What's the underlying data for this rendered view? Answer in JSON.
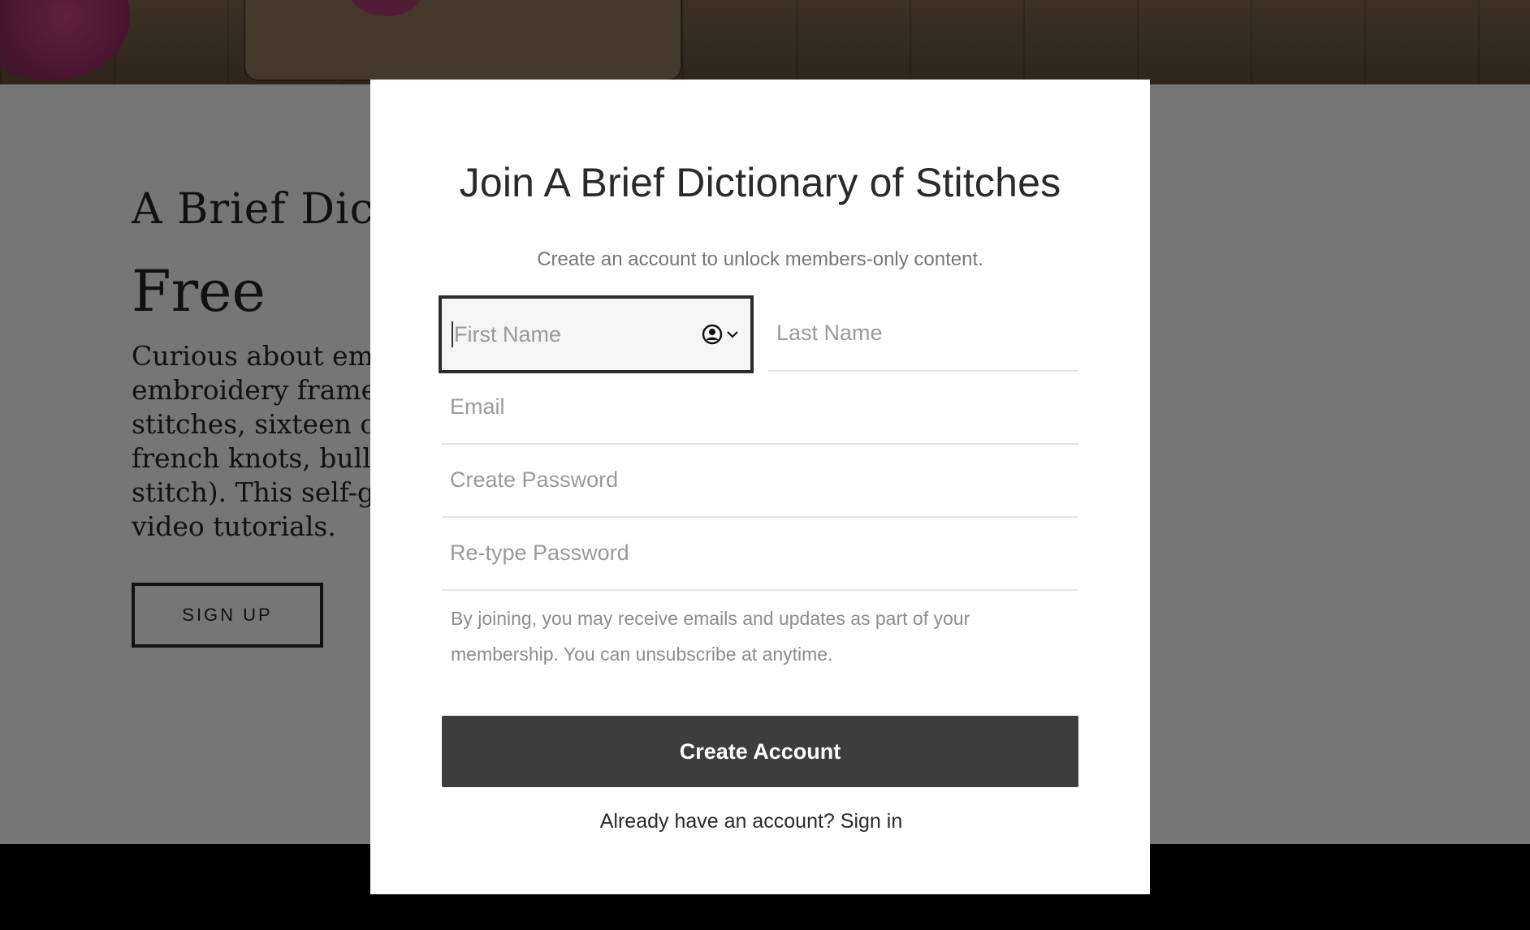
{
  "background": {
    "title": "A Brief Dictionary of Stitches",
    "subtitle": "Free",
    "paragraph_lines": [
      "Curious about embroidery? Learn how to set-up an",
      "embroidery frame, transfer designs onto fabric, and embroidery",
      "stitches, sixteen of them (stem stitch, split stitch, chain, daisy chain,",
      "french knots, bullion knots, satin stitch and diagonal satin",
      "stitch). This self-guided course includes almost five hours of",
      "video tutorials."
    ],
    "signup_label": "SIGN UP"
  },
  "modal": {
    "title": "Join A Brief Dictionary of Stitches",
    "subtitle": "Create an account to unlock members-only content.",
    "first_name_placeholder": "First Name",
    "last_name_placeholder": "Last Name",
    "email_placeholder": "Email",
    "password_placeholder": "Create Password",
    "retype_placeholder": "Re-type Password",
    "consent_text": "By joining, you may receive emails and updates as part of your membership. You can unsubscribe at anytime.",
    "create_button": "Create Account",
    "signin_prompt": "Already have an account? Sign in"
  },
  "icons": {
    "autofill": "person-circle-icon",
    "dropdown": "chevron-down-icon"
  },
  "colors": {
    "button_bg": "#3d3d3d",
    "overlay": "rgba(0,0,0,0.5)",
    "active_field_border": "#2c2c2c"
  }
}
